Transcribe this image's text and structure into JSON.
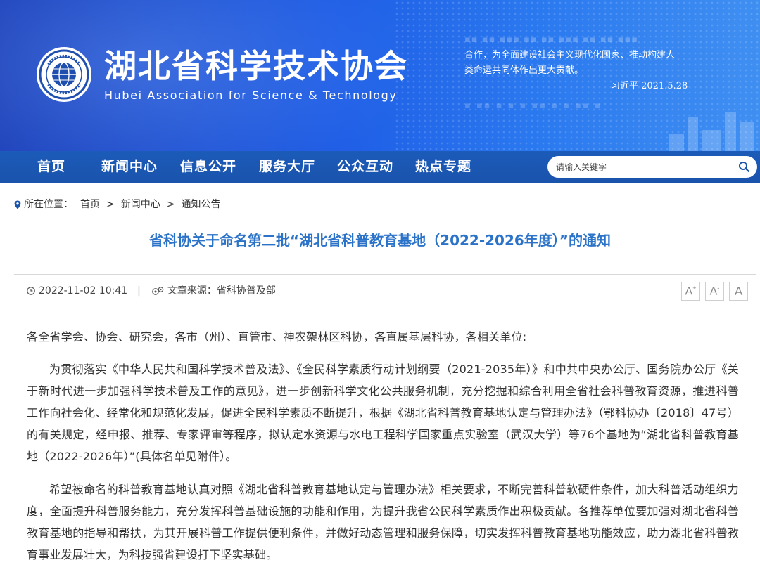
{
  "header": {
    "title": "湖北省科学技术协会",
    "subtitle": "Hubei Association for Science & Technology",
    "quote_lines": [
      "合作，为全面建设社会主义现代化国家、推动构建人",
      "类命运共同体作出更大贡献。"
    ],
    "quote_signature": "——习近平  2021.5.28"
  },
  "nav": {
    "items": [
      "首页",
      "新闻中心",
      "信息公开",
      "服务大厅",
      "公众互动",
      "热点专题"
    ],
    "search_placeholder": "请输入关键字"
  },
  "breadcrumb": {
    "label": "所在位置：",
    "items": [
      "首页",
      "新闻中心",
      "通知公告"
    ],
    "separator": ">"
  },
  "article": {
    "title": "省科协关于命名第二批“湖北省科普教育基地（2022-2026年度）”的通知",
    "date": "2022-11-02 10:41",
    "meta_separator": "|",
    "source_label": "文章来源：",
    "source": "省科协普及部",
    "font_buttons": [
      "A+",
      "A-",
      "A"
    ],
    "paragraphs": [
      "各全省学会、协会、研究会，各市（州）、直管市、神农架林区科协，各直属基层科协，各相关单位:",
      "为贯彻落实《中华人民共和国科学技术普及法》、《全民科学素质行动计划纲要（2021-2035年）》和中共中央办公厅、国务院办公厅《关于新时代进一步加强科学技术普及工作的意见》，进一步创新科学文化公共服务机制，充分挖掘和综合利用全省社会科普教育资源，推进科普工作向社会化、经常化和规范化发展，促进全民科学素质不断提升，根据《湖北省科普教育基地认定与管理办法》（鄂科协办〔2018〕47号）的有关规定，经申报、推荐、专家评审等程序，拟认定水资源与水电工程科学国家重点实验室（武汉大学）等76个基地为“湖北省科普教育基地（2022-2026年）”(具体名单见附件）。",
      "希望被命名的科普教育基地认真对照《湖北省科普教育基地认定与管理办法》相关要求，不断完善科普软硬件条件，加大科普活动组织力度，全面提升科普服务能力，充分发挥科普基础设施的功能和作用，为提升我省公民科学素质作出积极贡献。各推荐单位要加强对湖北省科普教育基地的指导和帮扶，为其开展科普工作提供便利条件，并做好动态管理和服务保障，切实发挥科普教育基地功能效应，助力湖北省科普教育事业发展壮大，为科技强省建设打下坚实基础。"
    ]
  },
  "colors": {
    "banner": "#1f5ee6",
    "nav": "#1a53ac",
    "title": "#2b72c9",
    "logo": "#1f4fae"
  },
  "icons": [
    "location-pin-icon",
    "search-icon",
    "clock-icon",
    "source-icon"
  ]
}
